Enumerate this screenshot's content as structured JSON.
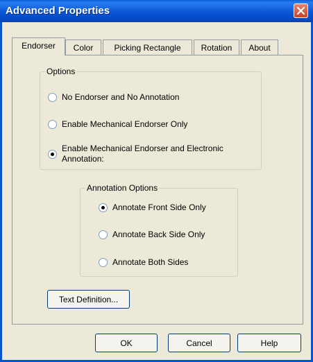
{
  "window": {
    "title": "Advanced Properties"
  },
  "tabs": [
    {
      "label": "Endorser",
      "active": true
    },
    {
      "label": "Color",
      "active": false
    },
    {
      "label": "Picking Rectangle",
      "active": false
    },
    {
      "label": "Rotation",
      "active": false
    },
    {
      "label": "About",
      "active": false
    }
  ],
  "options": {
    "legend": "Options",
    "items": [
      {
        "label": "No Endorser and No Annotation",
        "checked": false
      },
      {
        "label": "Enable Mechanical Endorser Only",
        "checked": false
      },
      {
        "label_line1": "Enable Mechanical Endorser and Electronic",
        "label_line2": "Annotation:",
        "checked": true
      }
    ]
  },
  "annotation_options": {
    "legend": "Annotation Options",
    "items": [
      {
        "label": "Annotate Front Side Only",
        "checked": true
      },
      {
        "label": "Annotate Back Side Only",
        "checked": false
      },
      {
        "label": "Annotate Both Sides",
        "checked": false
      }
    ]
  },
  "buttons": {
    "text_definition": "Text Definition...",
    "ok": "OK",
    "cancel": "Cancel",
    "help": "Help"
  }
}
